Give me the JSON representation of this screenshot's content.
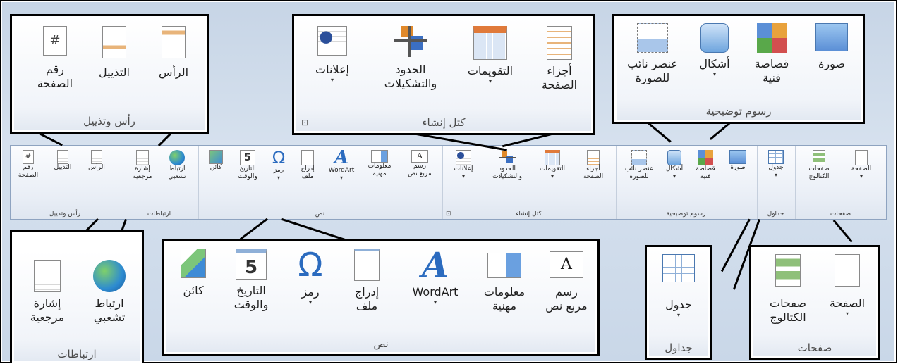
{
  "ribbon_groups": {
    "header_footer": {
      "title": "رأس وتذييل",
      "header": "الرأس",
      "footer": "التذييل",
      "page_number_1": "رقم",
      "page_number_2": "الصفحة"
    },
    "links": {
      "title": "ارتباطات",
      "hyperlink_1": "ارتباط",
      "hyperlink_2": "تشعبي",
      "bookmark_1": "إشارة",
      "bookmark_2": "مرجعية"
    },
    "text": {
      "title": "نص",
      "object": "كائن",
      "datetime_1": "التاريخ",
      "datetime_2": "والوقت",
      "symbol": "رمز",
      "insert_file_1": "إدراج",
      "insert_file_2": "ملف",
      "wordart": "WordArt",
      "quickparts_1": "معلومات",
      "quickparts_2": "مهنية",
      "textbox_1": "رسم",
      "textbox_2": "مربع نص"
    },
    "building_blocks": {
      "title": "كتل إنشاء",
      "advertisements": "إعلانات",
      "borders_1": "الحدود",
      "borders_2": "والتشكيلات",
      "calendars": "التقويمات",
      "page_parts_1": "أجزاء",
      "page_parts_2": "الصفحة"
    },
    "illustrations": {
      "title": "رسوم توضيحية",
      "placeholder_1": "عنصر نائب",
      "placeholder_2": "للصورة",
      "shapes": "أشكال",
      "clipart_1": "قصاصة",
      "clipart_2": "فنية",
      "picture": "صورة"
    },
    "tables": {
      "title": "جداول",
      "table": "جدول"
    },
    "pages": {
      "title": "صفحات",
      "catalog_1": "صفحات",
      "catalog_2": "الكتالوج",
      "page": "الصفحة"
    }
  },
  "icons": {
    "page_number_symbol": "#",
    "date_number": "5",
    "symbol_glyph": "Ω",
    "wordart_glyph": "A",
    "textbox_glyph": "A"
  },
  "dropdown_arrow": "▾",
  "launcher_glyph": "⊡",
  "colors": {
    "ribbon_bg": "#e9eef6",
    "frame_bg": "#c9d7e8",
    "accent_blue": "#2b6bbf"
  }
}
